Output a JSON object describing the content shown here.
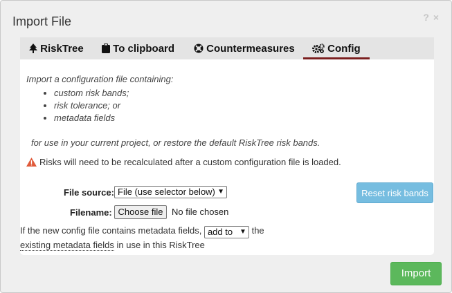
{
  "dialog": {
    "title": "Import File",
    "help_glyph": "?",
    "close_glyph": "×"
  },
  "tabs": [
    {
      "label": "RiskTree",
      "icon": "tree-icon"
    },
    {
      "label": "To clipboard",
      "icon": "clipboard-icon"
    },
    {
      "label": "Countermeasures",
      "icon": "lifebuoy-icon"
    },
    {
      "label": "Config",
      "icon": "gears-icon",
      "active": true
    }
  ],
  "config": {
    "intro": "Import a configuration file containing:",
    "items": [
      "custom risk bands;",
      "risk tolerance; or",
      "metadata fields"
    ],
    "for_use": "for use in your current project, or restore the default RiskTree risk bands.",
    "warning": "Risks will need to be recalculated after a custom configuration file is loaded.",
    "file_source_label": "File source:",
    "file_source_value": "File (use selector below)",
    "filename_label": "Filename:",
    "choose_file_label": "Choose file",
    "no_file_text": "No file chosen",
    "meta_prefix": "If the new config file contains metadata fields,",
    "meta_select_value": "add to",
    "meta_suffix": "the",
    "meta_link": "existing metadata fields",
    "meta_tail": "in use in this RiskTree",
    "reset_button": "Reset risk bands"
  },
  "footer": {
    "import_button": "Import"
  },
  "colors": {
    "active_tab_underline": "#7a1e1e",
    "warning_icon": "#e05a3a",
    "reset_button": "#76bde0",
    "import_button": "#5cb85c"
  }
}
